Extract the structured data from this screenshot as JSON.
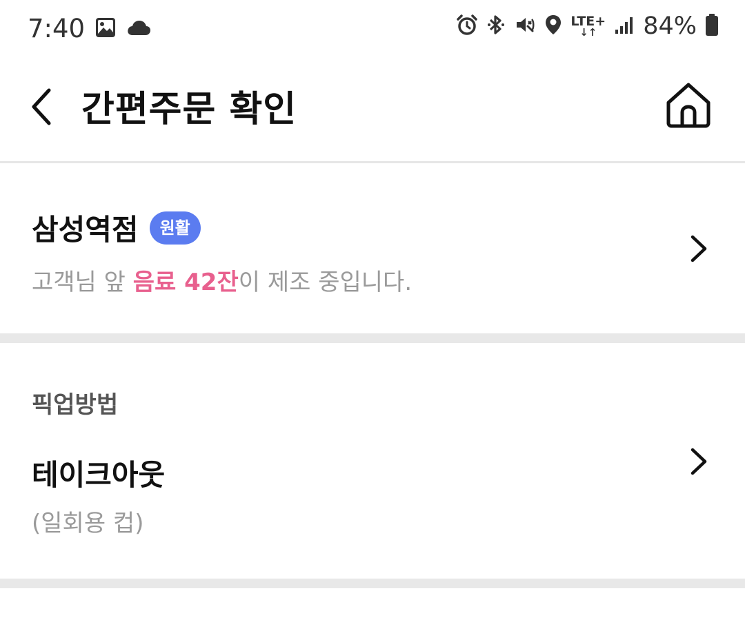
{
  "status_bar": {
    "time": "7:40",
    "network": "LTE+",
    "network_arrows": "↓↑",
    "battery": "84%",
    "left_icons": [
      "gallery-icon",
      "cloud-icon"
    ],
    "right_icons": [
      "alarm-icon",
      "bluetooth-icon",
      "vibrate-icon",
      "location-icon",
      "lte-icon",
      "signal-icon",
      "battery-icon"
    ]
  },
  "header": {
    "title": "간편주문 확인",
    "back_icon": "back-chevron-icon",
    "home_icon": "home-icon"
  },
  "store": {
    "name": "삼성역점",
    "badge": "원활",
    "queue_prefix": "고객님 앞 ",
    "queue_highlight": "음료 42잔",
    "queue_suffix": "이 제조 중입니다."
  },
  "pickup": {
    "heading": "픽업방법",
    "method": "테이크아웃",
    "note": "(일회용 컵)"
  },
  "colors": {
    "badge": "#5b7cf0",
    "highlight": "#e8608e",
    "divider": "#e8e8e8",
    "secondary_text": "#9a9a9a"
  }
}
